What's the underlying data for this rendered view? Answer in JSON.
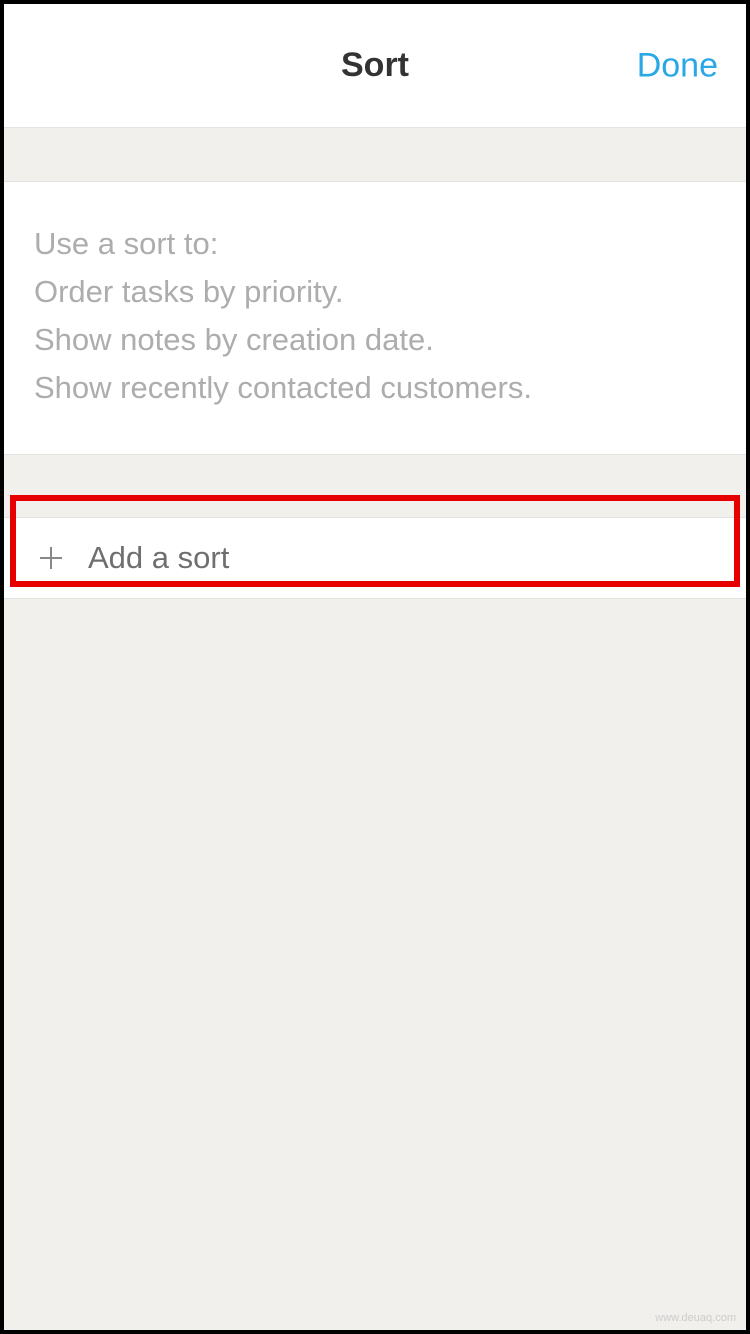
{
  "header": {
    "title": "Sort",
    "done_label": "Done"
  },
  "info": {
    "line1": "Use a sort to:",
    "line2": "Order tasks by priority.",
    "line3": "Show notes by creation date.",
    "line4": "Show recently contacted customers."
  },
  "add_sort": {
    "label": "Add a sort"
  },
  "watermark": "www.deuaq.com"
}
